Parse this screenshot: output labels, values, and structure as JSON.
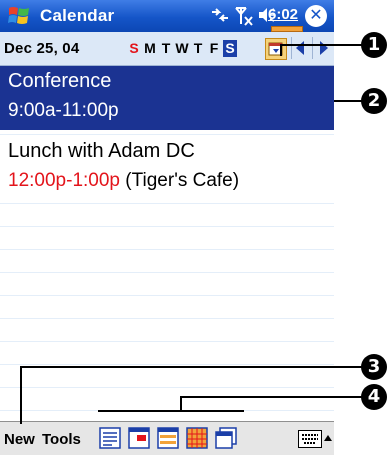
{
  "window": {
    "title": "Calendar",
    "time": "6:02",
    "close_glyph": "✕"
  },
  "date_bar": {
    "date": "Dec 25, 04",
    "weekdays": [
      "S",
      "M",
      "T",
      "W",
      "T",
      "F",
      "S"
    ],
    "selected_weekday_index": 6
  },
  "appointments": [
    {
      "title": "Conference",
      "time": "9:00a-11:00p",
      "location": "",
      "selected": true
    },
    {
      "title": "Lunch with Adam DC",
      "time": "12:00p-1:00p",
      "location": "(Tiger's Cafe)",
      "selected": false
    }
  ],
  "toolbar": {
    "new_label": "New",
    "tools_label": "Tools",
    "views": [
      "agenda-view",
      "day-view",
      "week-view",
      "month-view",
      "year-view"
    ]
  },
  "callouts": [
    "1",
    "2",
    "3",
    "4"
  ],
  "colors": {
    "title_bar": "#1555c8",
    "selected_row": "#1b3392",
    "accent_red": "#e3141b",
    "date_bar": "#dce8f7"
  }
}
